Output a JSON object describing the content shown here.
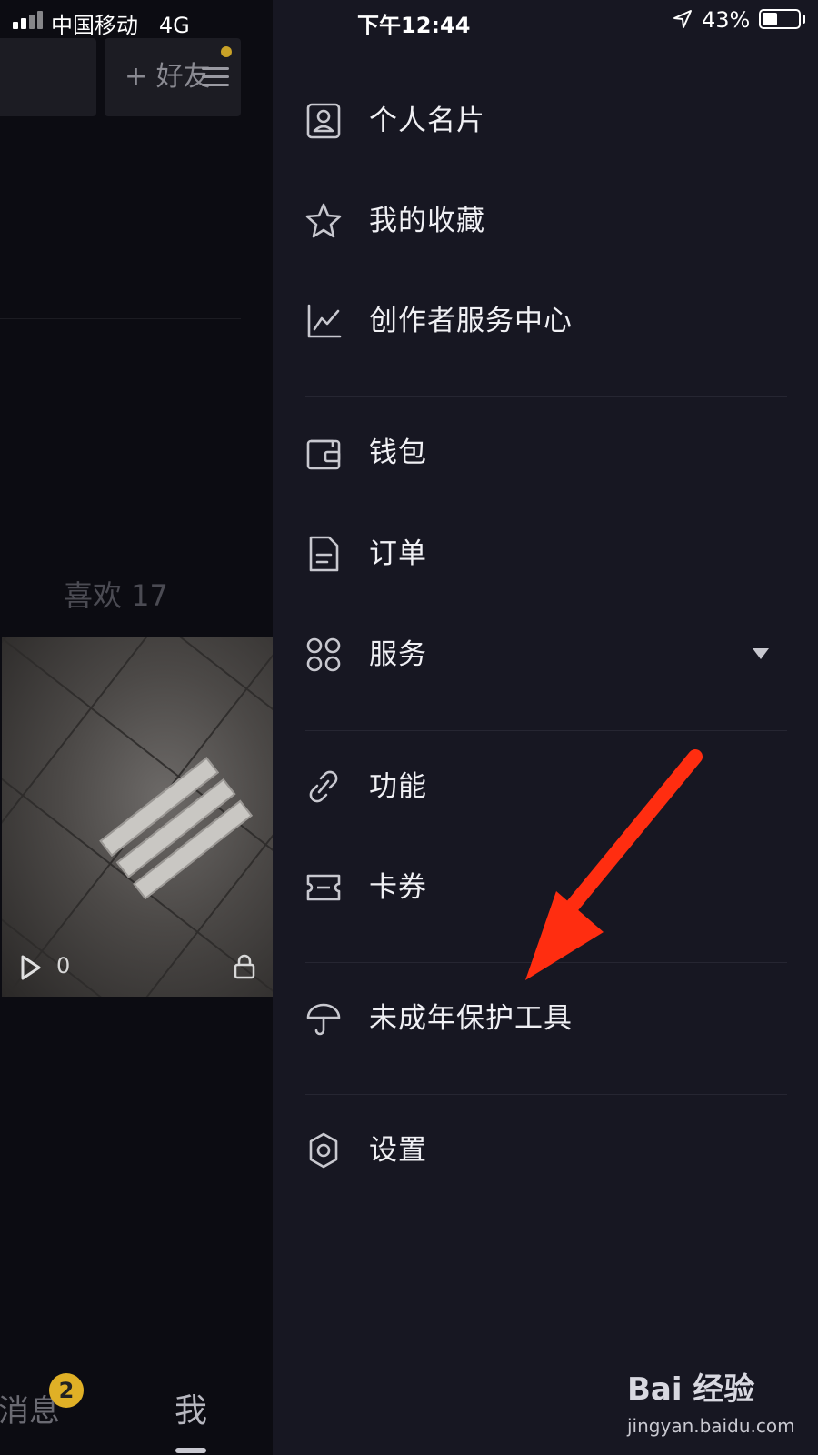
{
  "status_bar": {
    "carrier": "中国移动",
    "network": "4G",
    "time": "下午12:44",
    "battery_percent_text": "43%",
    "battery_level": 0.43
  },
  "background": {
    "add_friend_label": "+ 好友",
    "likes_label": "喜欢 17",
    "play_count": "0",
    "tab_messages_label": "消息",
    "tab_messages_badge": "2",
    "tab_me_label": "我"
  },
  "drawer": {
    "items": [
      {
        "label": "个人名片",
        "icon": "contact-card-icon"
      },
      {
        "label": "我的收藏",
        "icon": "star-icon"
      },
      {
        "label": "创作者服务中心",
        "icon": "chart-line-icon"
      },
      {
        "label": "钱包",
        "icon": "wallet-icon"
      },
      {
        "label": "订单",
        "icon": "document-icon"
      },
      {
        "label": "服务",
        "icon": "apps-grid-icon",
        "expandable": true
      },
      {
        "label": "功能",
        "icon": "link-icon"
      },
      {
        "label": "卡券",
        "icon": "ticket-icon"
      },
      {
        "label": "未成年保护工具",
        "icon": "umbrella-icon"
      },
      {
        "label": "设置",
        "icon": "gear-icon"
      }
    ]
  },
  "annotation": {
    "arrow_color": "#ff2d10"
  },
  "watermark": {
    "logo": "Bai 经验",
    "url": "jingyan.baidu.com"
  }
}
